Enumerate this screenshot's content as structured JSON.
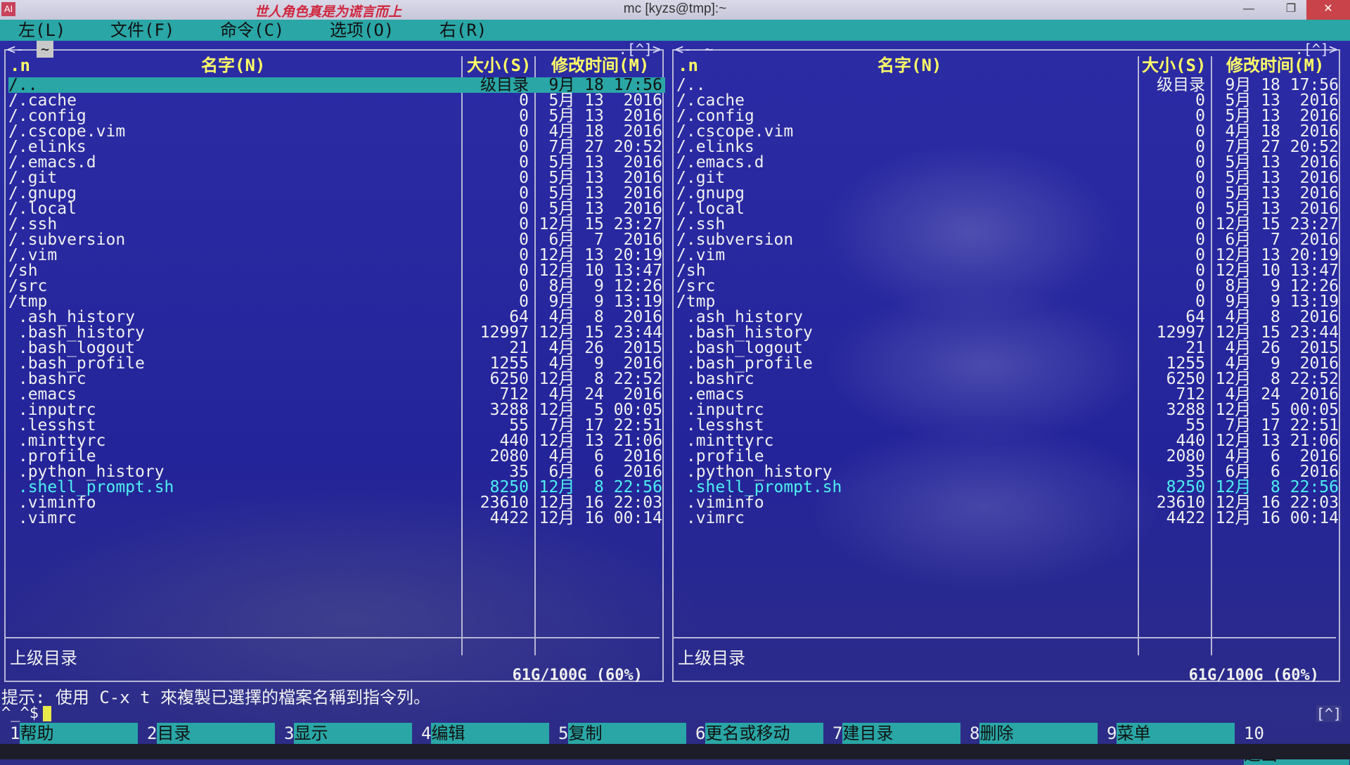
{
  "window": {
    "title": "mc [kyzs@tmp]:~",
    "slogan": "世人角色真是为谎言而上",
    "app_icon_label": "AI"
  },
  "menu": [
    "左(L)",
    "文件(F)",
    "命令(C)",
    "选项(O)",
    "右(R)"
  ],
  "panels": [
    {
      "path": "~",
      "corner_tag": ".[^]>",
      "left_tag": "<-",
      "sort_indicator": ".n",
      "col_name": "名字(N)",
      "col_size": "大小(S)",
      "col_time": "修改时间(M)",
      "info": "上级目录",
      "disk": "61G/100G (60%)"
    },
    {
      "path": "~",
      "corner_tag": ".[^]>",
      "left_tag": "<-",
      "sort_indicator": ".n",
      "col_name": "名字(N)",
      "col_size": "大小(S)",
      "col_time": "修改时间(M)",
      "info": "上级目录",
      "disk": "61G/100G (60%)"
    }
  ],
  "files": [
    {
      "name": "/..",
      "size": "级目录",
      "time": "9月 18 17:56"
    },
    {
      "name": "/.cache",
      "size": "0",
      "time": "5月 13  2016"
    },
    {
      "name": "/.config",
      "size": "0",
      "time": "5月 13  2016"
    },
    {
      "name": "/.cscope.vim",
      "size": "0",
      "time": "4月 18  2016"
    },
    {
      "name": "/.elinks",
      "size": "0",
      "time": "7月 27 20:52"
    },
    {
      "name": "/.emacs.d",
      "size": "0",
      "time": "5月 13  2016"
    },
    {
      "name": "/.git",
      "size": "0",
      "time": "5月 13  2016"
    },
    {
      "name": "/.gnupg",
      "size": "0",
      "time": "5月 13  2016"
    },
    {
      "name": "/.local",
      "size": "0",
      "time": "5月 13  2016"
    },
    {
      "name": "/.ssh",
      "size": "0",
      "time": "12月 15 23:27"
    },
    {
      "name": "/.subversion",
      "size": "0",
      "time": "6月  7  2016"
    },
    {
      "name": "/.vim",
      "size": "0",
      "time": "12月 13 20:19"
    },
    {
      "name": "/sh",
      "size": "0",
      "time": "12月 10 13:47"
    },
    {
      "name": "/src",
      "size": "0",
      "time": "8月  9 12:26"
    },
    {
      "name": "/tmp",
      "size": "0",
      "time": "9月  9 13:19"
    },
    {
      "name": " .ash_history",
      "size": "64",
      "time": "4月  8  2016"
    },
    {
      "name": " .bash_history",
      "size": "12997",
      "time": "12月 15 23:44"
    },
    {
      "name": " .bash_logout",
      "size": "21",
      "time": "4月 26  2015"
    },
    {
      "name": " .bash_profile",
      "size": "1255",
      "time": "4月  9  2016"
    },
    {
      "name": " .bashrc",
      "size": "6250",
      "time": "12月  8 22:52"
    },
    {
      "name": " .emacs",
      "size": "712",
      "time": "4月 24  2016"
    },
    {
      "name": " .inputrc",
      "size": "3288",
      "time": "12月  5 00:05"
    },
    {
      "name": " .lesshst",
      "size": "55",
      "time": "7月 17 22:51"
    },
    {
      "name": " .minttyrc",
      "size": "440",
      "time": "12月 13 21:06"
    },
    {
      "name": " .profile",
      "size": "2080",
      "time": "4月  6  2016"
    },
    {
      "name": " .python_history",
      "size": "35",
      "time": "6月  6  2016"
    },
    {
      "name": " .shell_prompt.sh",
      "size": "8250",
      "time": "12月  8 22:56"
    },
    {
      "name": " .viminfo",
      "size": "23610",
      "time": "12月 16 22:03"
    },
    {
      "name": " .vimrc",
      "size": "4422",
      "time": "12月 16 00:14"
    }
  ],
  "hint": "提示: 使用 C-x t 來複製已選擇的檔案名稱到指令列。",
  "prompt": "^_^$",
  "prompt_tag": "[^]",
  "fkeys": [
    {
      "num": "1",
      "label": "帮助"
    },
    {
      "num": "2",
      "label": "目录"
    },
    {
      "num": "3",
      "label": "显示"
    },
    {
      "num": "4",
      "label": "编辑"
    },
    {
      "num": "5",
      "label": "复制"
    },
    {
      "num": "6",
      "label": "更名或移动"
    },
    {
      "num": "7",
      "label": "建目录"
    },
    {
      "num": "8",
      "label": "删除"
    },
    {
      "num": "9",
      "label": "菜单"
    },
    {
      "num": "10",
      "label": "退出"
    }
  ],
  "colors": {
    "panel_bg": "#2c2ca6",
    "accent": "#2aa6a6",
    "header_text": "#ffff66",
    "exec_file": "#4ff0f0"
  }
}
